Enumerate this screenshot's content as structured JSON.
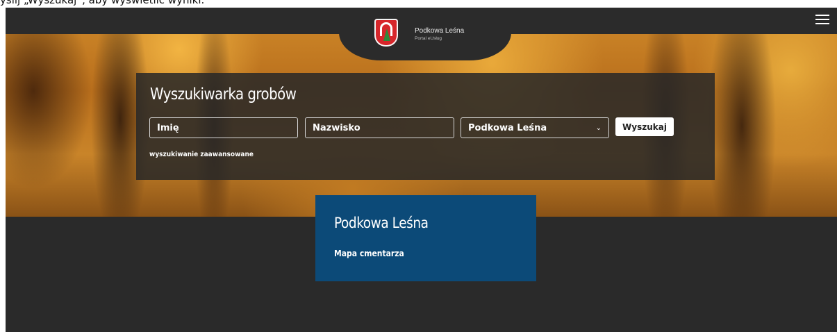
{
  "caption": {
    "text": "yślij „Wyszukaj”, aby wyświetlić wyniki."
  },
  "header": {
    "brand_name": "Podkowa Leśna",
    "brand_subtitle": "Portal eUsług",
    "menu_icon": "hamburger-icon",
    "crest_icon": "coat-of-arms-icon"
  },
  "search": {
    "title": "Wyszukiwarka grobów",
    "first_name_placeholder": "Imię",
    "last_name_placeholder": "Nazwisko",
    "location_selected": "Podkowa Leśna",
    "submit_label": "Wyszukaj",
    "advanced_link": "wyszukiwanie zaawansowane"
  },
  "cemetery_card": {
    "title": "Podkowa Leśna",
    "map_link": "Mapa cmentarza",
    "color": "#0c4a78"
  }
}
